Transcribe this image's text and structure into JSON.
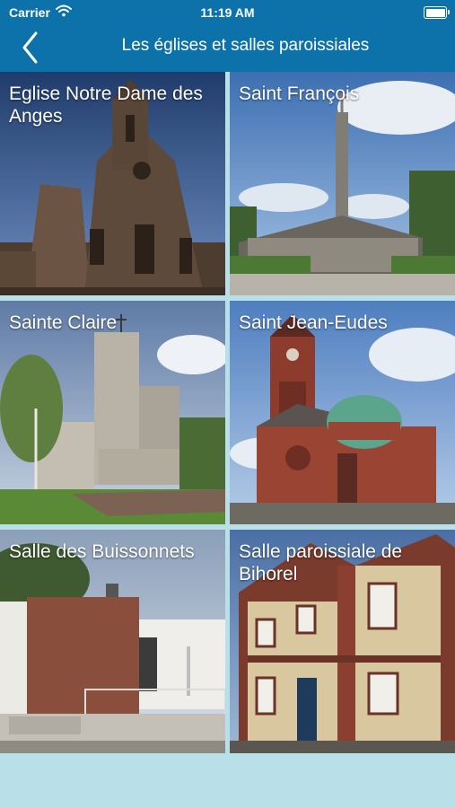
{
  "status_bar": {
    "carrier": "Carrier",
    "time": "11:19 AM"
  },
  "nav": {
    "title": "Les églises et salles paroissiales",
    "back_icon": "chevron-left-icon"
  },
  "tiles": [
    {
      "label": "Eglise Notre Dame des Anges"
    },
    {
      "label": "Saint François"
    },
    {
      "label": "Sainte Claire"
    },
    {
      "label": "Saint Jean-Eudes"
    },
    {
      "label": "Salle des Buissonnets"
    },
    {
      "label": "Salle paroissiale de Bihorel"
    }
  ],
  "colors": {
    "header": "#0d72a9",
    "background": "#b9dfe9"
  }
}
